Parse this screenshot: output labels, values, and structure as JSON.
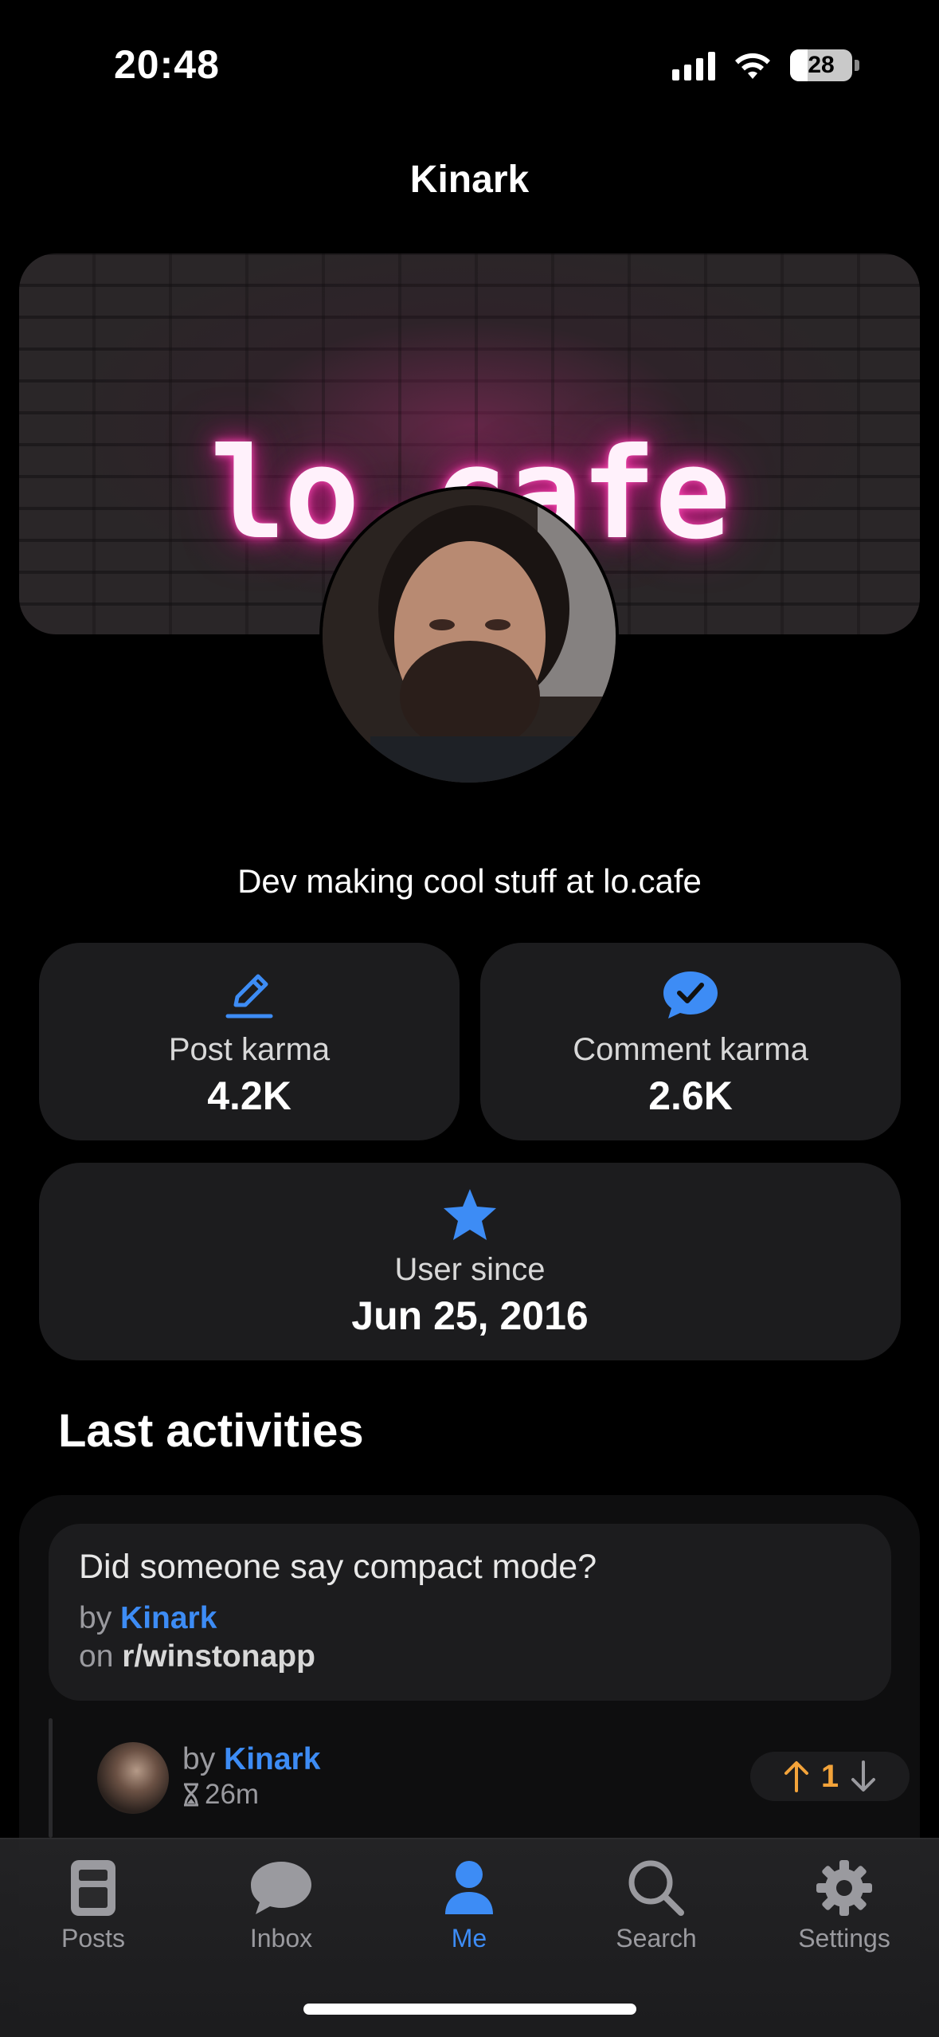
{
  "status_bar": {
    "time": "20:48",
    "battery": "28",
    "battery_level": 0.28
  },
  "nav": {
    "title": "Kinark"
  },
  "banner": {
    "logo_text": "lo.cafe"
  },
  "profile": {
    "bio": "Dev making cool stuff at lo.cafe"
  },
  "stats": {
    "post_karma": {
      "label": "Post karma",
      "value": "4.2K",
      "icon": "pencil-icon"
    },
    "comment_karma": {
      "label": "Comment karma",
      "value": "2.6K",
      "icon": "chat-check-icon"
    },
    "user_since": {
      "label": "User since",
      "value": "Jun 25, 2016",
      "icon": "star-icon"
    }
  },
  "activities": {
    "title": "Last activities",
    "post": {
      "title": "Did someone say compact mode?",
      "by_prefix": "by",
      "author": "Kinark",
      "on_prefix": "on",
      "subreddit": "r/winstonapp"
    },
    "comment": {
      "by_prefix": "by",
      "author": "Kinark",
      "time": "26m",
      "votes": "1"
    }
  },
  "tabbar": {
    "tabs": [
      {
        "label": "Posts",
        "icon": "posts-icon",
        "active": false
      },
      {
        "label": "Inbox",
        "icon": "chat-bubble-icon",
        "active": false
      },
      {
        "label": "Me",
        "icon": "person-icon",
        "active": true
      },
      {
        "label": "Search",
        "icon": "search-icon",
        "active": false
      },
      {
        "label": "Settings",
        "icon": "gear-icon",
        "active": false
      }
    ]
  },
  "colors": {
    "accent": "#3d8cf5",
    "upvote": "#f3a33a",
    "inactive_tab": "#9a9a9f"
  }
}
